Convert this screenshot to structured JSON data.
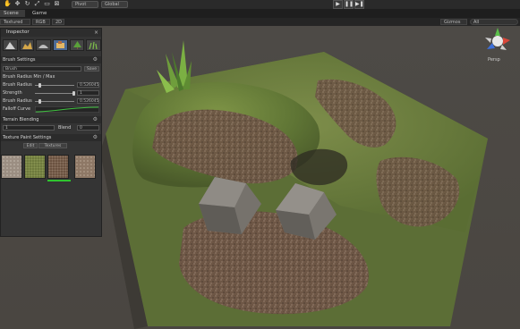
{
  "toolbar": {
    "pivot_label": "Pivot",
    "global_label": "Global",
    "play_glyph": "▶",
    "pause_glyph": "❚❚",
    "step_glyph": "▶❚"
  },
  "tabs": [
    {
      "label": "Scene",
      "active": true
    },
    {
      "label": "Game",
      "active": false
    }
  ],
  "scene_bar": {
    "shading_mode": "Textured",
    "render_mode": "RGB",
    "dimension": "2D",
    "gizmos_label": "Gizmos",
    "search_placeholder": "All"
  },
  "gizmo": {
    "label": "Persp"
  },
  "panel": {
    "title": "Inspector",
    "tool_icons": [
      "raise-terrain-icon",
      "paint-height-icon",
      "smooth-icon",
      "paint-texture-icon",
      "tree-icon",
      "details-icon"
    ],
    "brush_section": {
      "title": "Brush Settings",
      "preset_field": "Brush",
      "preset_button": "Save",
      "mode_label": "Brush Radius Min / Max",
      "rows": [
        {
          "label": "Brush Radius",
          "value": "0.526045"
        },
        {
          "label": "Strength",
          "value": "1"
        },
        {
          "label": "Brush Radius",
          "value": "0.526045"
        }
      ],
      "falloff_label": "Falloff Curve"
    },
    "blend_section": {
      "title": "Terrain Blending",
      "left_value": "1",
      "right_label": "Blend",
      "right_value": "0"
    },
    "texture_section": {
      "title": "Texture Paint Settings",
      "edit_button": "Edit",
      "textures_button": "Textures",
      "textures": [
        {
          "name": "rock-texture",
          "color": "#9b8e82"
        },
        {
          "name": "grass-texture",
          "color": "#6e7a3d"
        },
        {
          "name": "dirt-texture",
          "color": "#6b5240"
        },
        {
          "name": "soil-texture",
          "color": "#8e7866"
        }
      ],
      "selected_index": 2
    }
  },
  "colors": {
    "grass": "#5e7a35",
    "dirt": "#6b5443",
    "rock": "#8a8680",
    "selection": "#2fc32f",
    "background": "#4b4844"
  }
}
